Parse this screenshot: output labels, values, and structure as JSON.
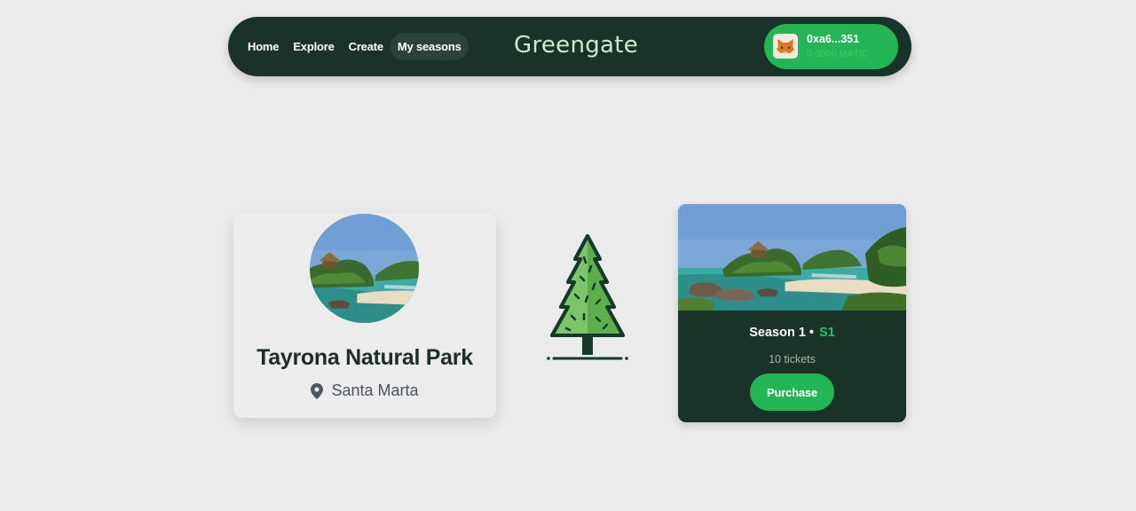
{
  "nav": {
    "links": [
      "Home",
      "Explore",
      "Create",
      "My seasons"
    ],
    "active_link": "My seasons",
    "brand": "Greengate"
  },
  "wallet": {
    "address": "0xa6...351",
    "balance": "0.0000 MATIC",
    "avatar_icon": "metamask-fox-icon"
  },
  "park": {
    "name": "Tayrona Natural Park",
    "location": "Santa Marta",
    "location_icon": "map-pin-icon"
  },
  "decoration": {
    "icon": "pine-tree-icon"
  },
  "season": {
    "title": "Season 1 •",
    "code": "S1",
    "tickets": "10 tickets",
    "purchase_label": "Purchase"
  },
  "colors": {
    "background": "#ebebeb",
    "nav_bg": "#1a3329",
    "accent_green": "#22b654",
    "brand_text": "#c8ecd0",
    "code_green": "#22c55e"
  }
}
